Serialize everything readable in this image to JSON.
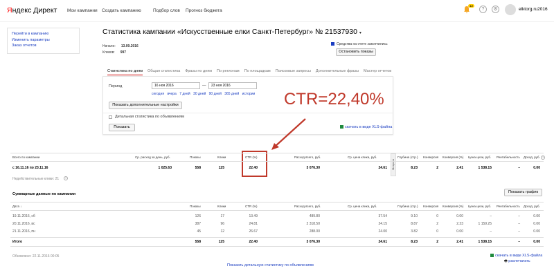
{
  "header": {
    "logo_y": "Я",
    "logo_rest": "ндекс Директ",
    "nav": [
      "Мои кампании",
      "Создать кампанию",
      "Подбор слов",
      "Прогноз бюджета"
    ],
    "badge": "12",
    "help": "?",
    "username": "elktorg.ru2016"
  },
  "sidebar": {
    "links": [
      "Перейти в кампанию",
      "Изменить параметры",
      "Заказ отчетов"
    ]
  },
  "campaign": {
    "title": "Статистика кампании «Искусственные елки Санкт-Петербург» № 21537930",
    "start_label": "Начало:",
    "start_value": "13.09.2016",
    "clicks_label": "Кликов:",
    "clicks_value": "997",
    "funds_notice": "Средства на счете закончились",
    "stop_button": "Остановить показы"
  },
  "tabs": [
    "Статистика по дням",
    "Общая статистика",
    "Фразы по дням",
    "По регионам",
    "По площадкам",
    "Поисковые запросы",
    "Дополнительные фразы",
    "Мастер отчетов"
  ],
  "settings": {
    "period_label": "Период",
    "date_from": "16 ноя 2016",
    "date_to": "23 ноя 2016",
    "dash": "—",
    "quick": [
      "сегодня",
      "вчера",
      "7 дней",
      "30 дней",
      "90 дней",
      "365 дней",
      "истории"
    ],
    "more_settings": "Показать дополнительные настройки",
    "detail_checkbox": "Детальная статистика по объявлениям",
    "show_button": "Показать",
    "xls_link": "скачать в виде XLS-файла"
  },
  "annotation": "CTR=22,40%",
  "summary_table": {
    "headers": [
      "Всего по кампании",
      "Ср. расход за день, руб.",
      "Показы",
      "Клики",
      "CTR (%)",
      "Расход всего, руб.",
      "Ср. цена клика, руб.",
      "Глубина (стр.)",
      "Конверсия",
      "Конверсия (%)",
      "Цена цели, руб.",
      "Рентабельность",
      "Доход, руб."
    ],
    "metrica_tag": "Метрика",
    "row_label": "с 16.11.16 по 23.11.16",
    "row": [
      "1 025.63",
      "558",
      "125",
      "22.40",
      "3 076.30",
      "24.61",
      "8.23",
      "2",
      "2.41",
      "1 538.15",
      "–",
      "0.00"
    ],
    "invalid_clicks": "Недействительные клики: 21"
  },
  "daily_table": {
    "title": "Суммарные данные по кампании",
    "chart_button": "Показать график",
    "headers": [
      "Дата",
      "Показы",
      "Клики",
      "CTR (%)",
      "Расход всего, руб.",
      "Ср. цена клика, руб.",
      "Глубина (стр.)",
      "Конверсия",
      "Конверсия (%)",
      "Цена цели, руб.",
      "Рентабельность",
      "Доход, руб."
    ],
    "sort_arrow": "↓",
    "rows": [
      [
        "19.11.2016, сб",
        "126",
        "17",
        "13.49",
        "489.80",
        "37.54",
        "9.10",
        "0",
        "0.00",
        "–",
        "–",
        "0.00"
      ],
      [
        "20.11.2016, вс",
        "387",
        "96",
        "24.81",
        "2 318.50",
        "24.15",
        "8.87",
        "2",
        "2.23",
        "1 159.25",
        "–",
        "0.00"
      ],
      [
        "21.11.2016, пн",
        "45",
        "12",
        "26.67",
        "288.00",
        "24.00",
        "3.82",
        "0",
        "0.00",
        "–",
        "–",
        "0.00"
      ]
    ],
    "total": [
      "Итого",
      "558",
      "125",
      "22.40",
      "3 076.30",
      "24.61",
      "8.23",
      "2",
      "2.41",
      "1 538.15",
      "–",
      "0.00"
    ]
  },
  "footer": {
    "updated": "Обновлено: 22.11.2016 00:05",
    "xls_link": "скачать в виде XLS-файла",
    "print_link": "распечатать",
    "detail_link": "Показать детальную статистику по объявлениям"
  },
  "colors": {
    "annotation": "#c0392b",
    "link": "#1a3dc1",
    "active_tab_underline": "#cc0000"
  }
}
